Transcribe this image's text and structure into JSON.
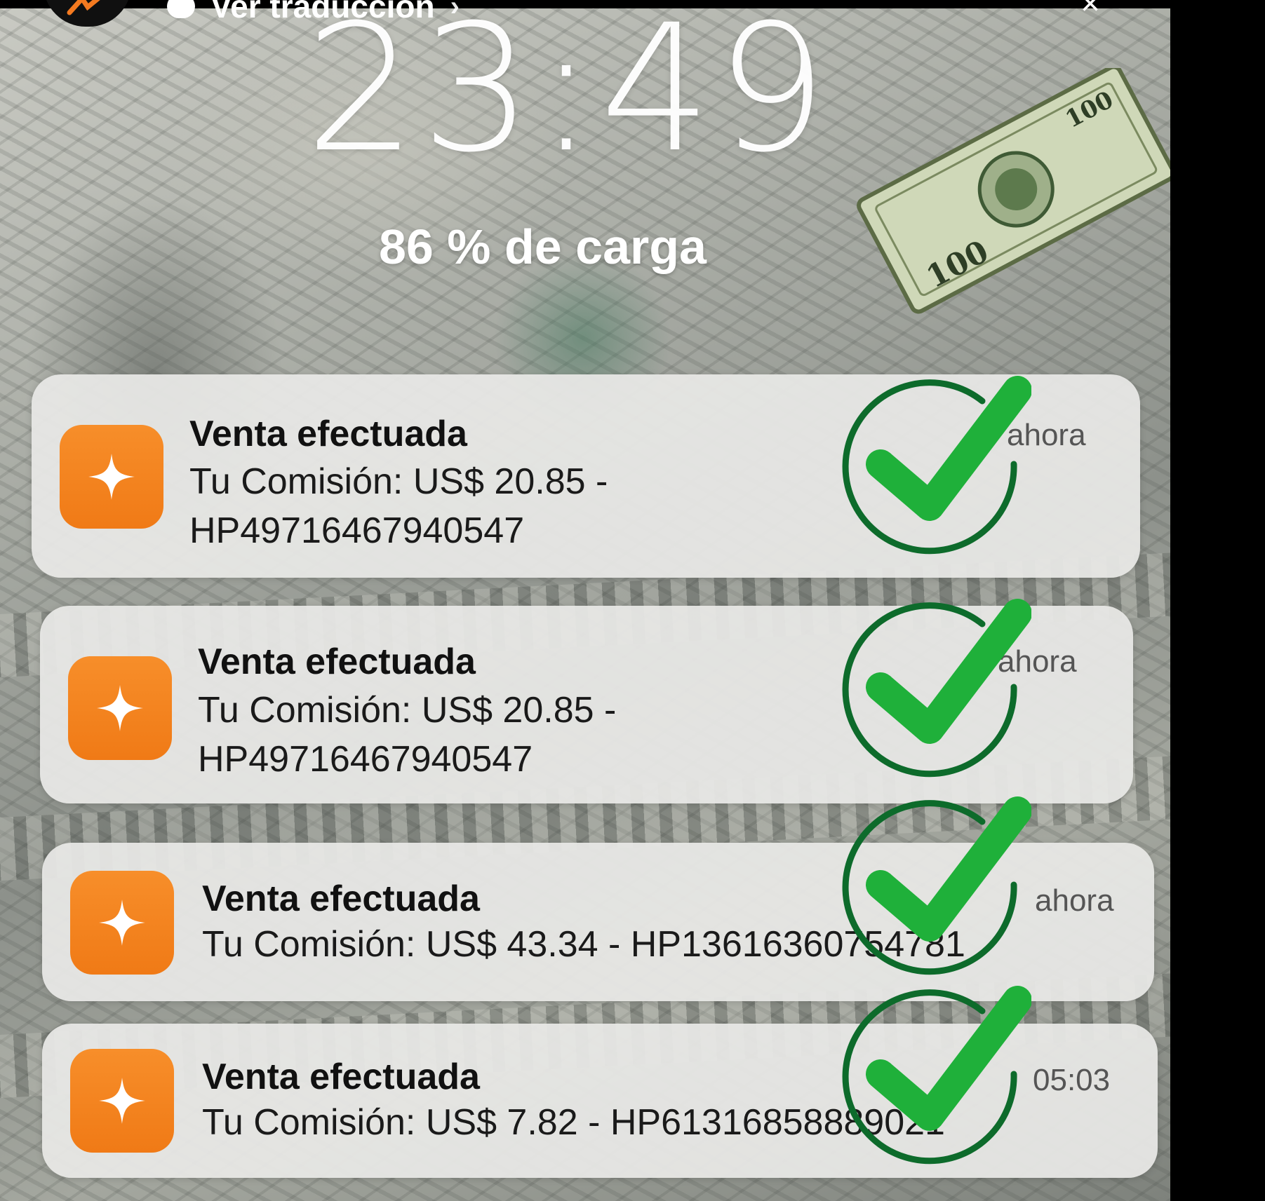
{
  "story": {
    "translate_label": "Ver traducción",
    "translate_chevron": "›",
    "close_label": "×"
  },
  "lockscreen": {
    "time": "23:49",
    "charge": "86 % de carga"
  },
  "notifications": [
    {
      "title": "Venta efectuada",
      "body_line1": "Tu Comisión: US$ 20.85 -",
      "body_line2": "HP49716467940547",
      "time": "ahora",
      "icon": "sparkle-icon"
    },
    {
      "title": "Venta efectuada",
      "body_line1": "Tu Comisión: US$ 20.85 -",
      "body_line2": "HP49716467940547",
      "time": "ahora",
      "icon": "sparkle-icon"
    },
    {
      "title": "Venta efectuada",
      "body_line1": "Tu Comisión: US$ 43.34 - HP136163607​54781",
      "time": "ahora",
      "icon": "sparkle-icon"
    },
    {
      "title": "Venta efectuada",
      "body_line1": "Tu Comisión: US$ 7.82 - HP613168588​89021",
      "time": "05:03",
      "icon": "sparkle-icon"
    }
  ],
  "colors": {
    "accent_orange": "#f47a20",
    "check_green": "#1fb03a",
    "check_dark_green": "#0d6b2b"
  }
}
